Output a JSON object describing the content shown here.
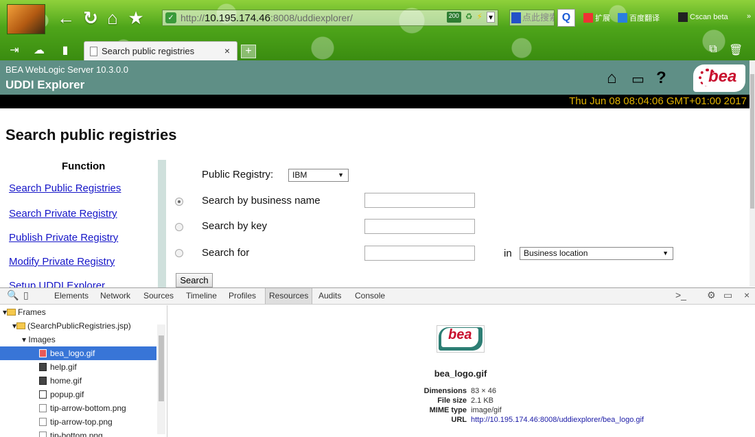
{
  "browser": {
    "url_scheme": "http://",
    "url_host": "10.195.174.46",
    "url_rest": ":8008/uddiexplorer/",
    "url_status_badge": "200",
    "search_placeholder": "点此搜索",
    "ext_label_1": "扩展",
    "ext_label_2": "百度翻译",
    "ext_label_3": "Cscan beta",
    "overflow_label": "»",
    "tab_title": "Search public registries",
    "tab_close": "×",
    "new_tab": "+"
  },
  "bea": {
    "product": "BEA WebLogic Server 10.3.0.0",
    "app": "UDDI Explorer",
    "logo_text": "bea",
    "date": "Thu Jun 08 08:04:06 GMT+01:00 2017"
  },
  "page": {
    "title": "Search public registries",
    "function_heading": "Function",
    "function_links": [
      "Search Public Registries",
      "Search Private Registry",
      "Publish Private Registry",
      "Modify Private Registry",
      "Setup UDDI Explorer"
    ],
    "form": {
      "registry_label": "Public Registry:",
      "registry_value": "IBM",
      "opt_business_name": "Search by business name",
      "opt_key": "Search by key",
      "opt_search_for": "Search for",
      "in_label": "in",
      "in_value": "Business location",
      "selected_option": "business_name",
      "search_button": "Search"
    }
  },
  "devtools": {
    "tabs": [
      "Elements",
      "Network",
      "Sources",
      "Timeline",
      "Profiles",
      "Resources",
      "Audits",
      "Console"
    ],
    "active_tab": "Resources",
    "tree": {
      "frames": "Frames",
      "frame": "(SearchPublicRegistries.jsp)",
      "images": "Images",
      "files": [
        "bea_logo.gif",
        "help.gif",
        "home.gif",
        "popup.gif",
        "tip-arrow-bottom.png",
        "tip-arrow-top.png",
        "tip-bottom.png"
      ]
    },
    "preview": {
      "name": "bea_logo.gif",
      "dimensions_label": "Dimensions",
      "dimensions": "83 × 46",
      "filesize_label": "File size",
      "filesize": "2.1 KB",
      "mime_label": "MIME type",
      "mime": "image/gif",
      "url_label": "URL",
      "url": "http://10.195.174.46:8008/uddiexplorer/bea_logo.gif"
    }
  },
  "colors": {
    "bea_header": "#5f8f86",
    "date_text": "#e1b300",
    "link": "#1515c8",
    "devtools_selection": "#3875d7"
  }
}
